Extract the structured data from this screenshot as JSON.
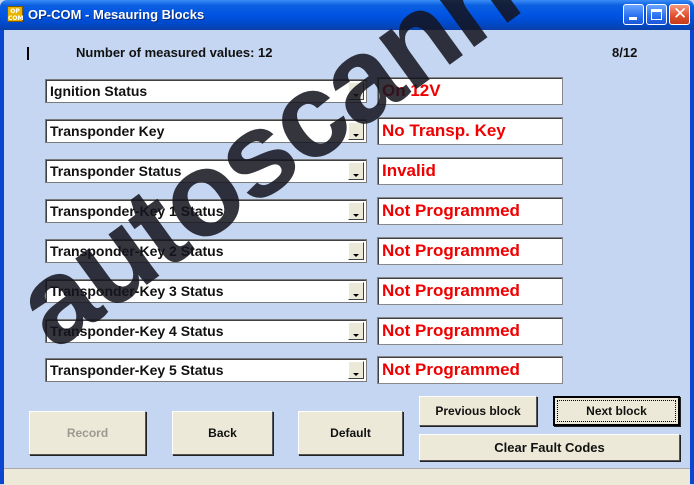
{
  "window": {
    "title": "OP-COM - Mesauring Blocks",
    "icon_text_top": "OP",
    "icon_text_bottom": "COM",
    "icon": "opcom-app-icon"
  },
  "header": {
    "count_label": "Number of measured values: 12",
    "page_counter": "8/12"
  },
  "rows": [
    {
      "label": "Ignition Status",
      "value": "On  12V"
    },
    {
      "label": "Transponder Key",
      "value": "No Transp. Key"
    },
    {
      "label": "Transponder Status",
      "value": "Invalid"
    },
    {
      "label": "Transponder-Key 1 Status",
      "value": "Not Programmed"
    },
    {
      "label": "Transponder-Key 2 Status",
      "value": "Not Programmed"
    },
    {
      "label": "Transponder-Key 3 Status",
      "value": "Not Programmed"
    },
    {
      "label": "Transponder-Key 4 Status",
      "value": "Not Programmed"
    },
    {
      "label": "Transponder-Key 5 Status",
      "value": "Not Programmed"
    }
  ],
  "buttons": {
    "record": "Record",
    "back": "Back",
    "default": "Default",
    "previous_block": "Previous block",
    "next_block": "Next block",
    "clear_fault_codes": "Clear Fault Codes"
  },
  "watermark": "autoscanner",
  "colors": {
    "value_text": "#f00000",
    "client_background": "#c4d6f2",
    "titlebar": "#0054e3"
  }
}
